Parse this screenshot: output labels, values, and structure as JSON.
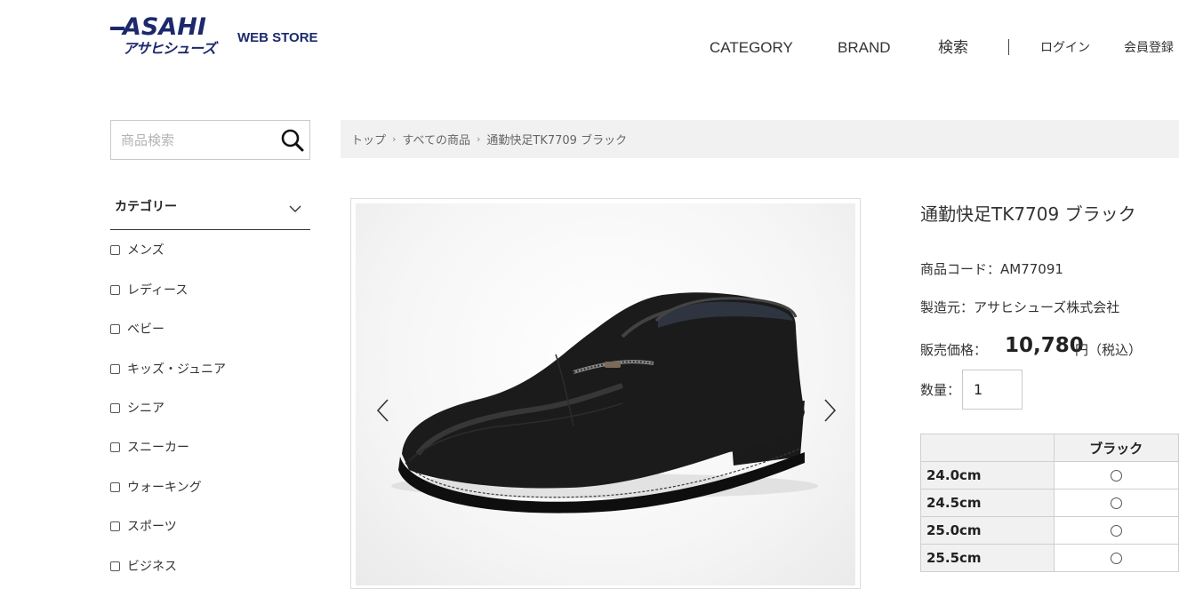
{
  "header": {
    "logo_latin": "ASAHI",
    "logo_kana": "アサヒシューズ",
    "store_label": "WEB STORE",
    "nav": [
      "CATEGORY",
      "BRAND",
      "検索"
    ],
    "login": "ログイン",
    "register": "会員登録"
  },
  "search": {
    "placeholder": "商品検索"
  },
  "breadcrumb": [
    "トップ",
    "すべての商品",
    "通勤快足TK7709 ブラック"
  ],
  "sidebar": {
    "category_title": "カテゴリー",
    "categories": [
      "メンズ",
      "レディース",
      "ベビー",
      "キッズ・ジュニア",
      "シニア",
      "スニーカー",
      "ウォーキング",
      "スポーツ",
      "ビジネス"
    ]
  },
  "product": {
    "title": "通勤快足TK7709 ブラック",
    "code_label": "商品コード：AM77091",
    "maker_label": "製造元：アサヒシューズ株式会社",
    "price_label": "販売価格：",
    "price": "10,780",
    "price_unit": "円（税込）",
    "qty_label": "数量：",
    "qty_value": "1",
    "color_header": "ブラック",
    "sizes": [
      "24.0cm",
      "24.5cm",
      "25.0cm",
      "25.5cm"
    ]
  },
  "colors": {
    "brand": "#1c2a6b",
    "breadcrumb_bg": "#f1f1f1"
  }
}
